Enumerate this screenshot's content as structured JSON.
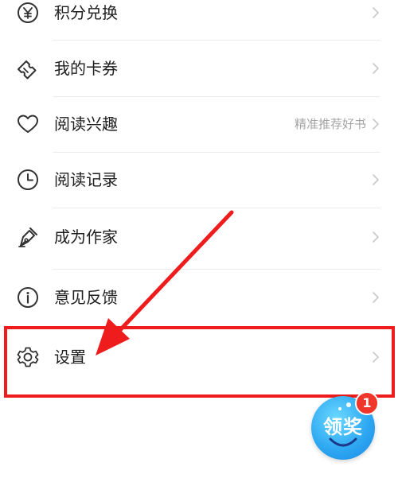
{
  "menu": {
    "items": [
      {
        "label": "积分兑换",
        "icon": "yuan-coin-icon",
        "hint": ""
      },
      {
        "label": "我的卡券",
        "icon": "ticket-icon",
        "hint": ""
      },
      {
        "label": "阅读兴趣",
        "icon": "heart-icon",
        "hint": "精准推荐好书"
      },
      {
        "label": "阅读记录",
        "icon": "clock-icon",
        "hint": ""
      },
      {
        "label": "成为作家",
        "icon": "pen-nib-icon",
        "hint": ""
      },
      {
        "label": "意见反馈",
        "icon": "info-icon",
        "hint": ""
      },
      {
        "label": "设置",
        "icon": "gear-icon",
        "hint": ""
      }
    ]
  },
  "reward": {
    "label": "领奖",
    "badge_count": "1"
  },
  "colors": {
    "annotation": "#ee1c1c",
    "reward_bg": "#2fa9f2",
    "badge_bg": "#f0352b",
    "text": "#1e1e1e",
    "hint": "#a4a4a4"
  }
}
